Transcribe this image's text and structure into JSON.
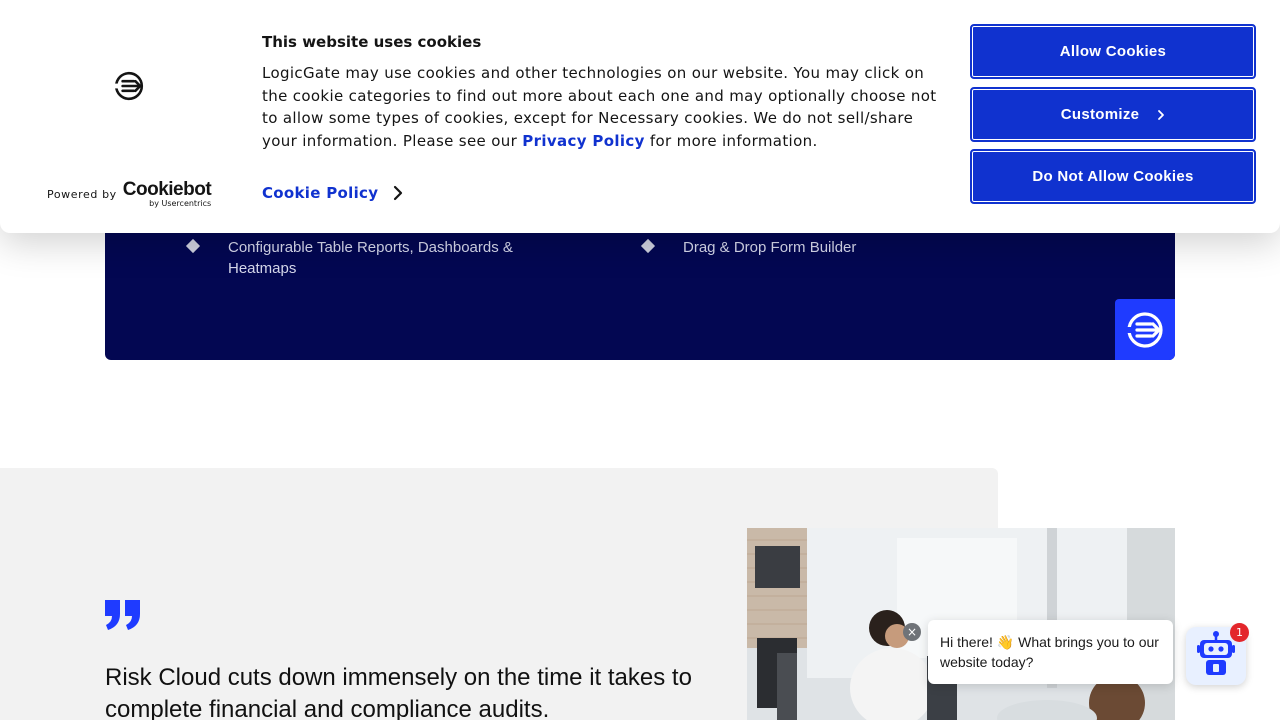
{
  "features": {
    "item_1": "Configurable Table Reports, Dashboards & Heatmaps",
    "item_2": "Drag & Drop Form Builder"
  },
  "testimonial": {
    "quote": "Risk Cloud cuts down immensely on the time it takes to complete financial and compliance audits."
  },
  "cookie_banner": {
    "title": "This website uses cookies",
    "body_text": "LogicGate may use cookies and other technologies on our website. You may click on the cookie categories to find out more about each one and may optionally choose not to allow some types of cookies, except for Necessary cookies.  We do not sell/share your information. Please see our ",
    "privacy_link": "Privacy Policy",
    "body_suffix": " for more information.",
    "cookie_policy_link": "Cookie Policy",
    "powered_by": "Powered by",
    "cookiebot_brand": "Cookiebot",
    "cookiebot_sub": "by Usercentrics",
    "buttons": {
      "allow": "Allow Cookies",
      "customize": "Customize",
      "deny": "Do Not Allow Cookies"
    }
  },
  "chat": {
    "close_glyph": "×",
    "message": "Hi there! 👋 What brings you to our website today?",
    "badge_count": "1"
  },
  "colors": {
    "navy_panel": "#030752",
    "accent_blue": "#1032cf",
    "logo_blue": "#1f3bff",
    "badge_red": "#e3262b"
  },
  "icons": {
    "brand_logo": "logicgate-icon",
    "quote": "quote-icon",
    "chevron": "chevron-right-icon",
    "bot": "robot-icon"
  }
}
